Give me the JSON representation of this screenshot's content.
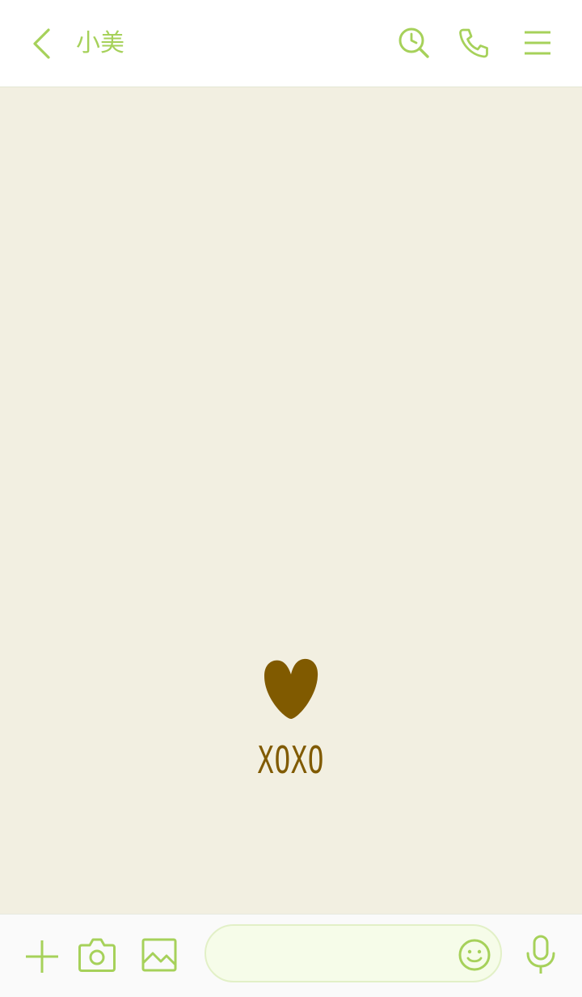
{
  "header": {
    "contact_name": "小美"
  },
  "chat": {
    "sticker_text": "XOXO"
  },
  "composer": {
    "message_value": "",
    "message_placeholder": ""
  },
  "colors": {
    "accent_green": "#a6d15a",
    "chat_background": "#f2efe1",
    "sticker_brown": "#805a00"
  },
  "icons": [
    "back-arrow-icon",
    "search-history-icon",
    "phone-icon",
    "menu-icon",
    "plus-icon",
    "camera-icon",
    "image-icon",
    "emoji-icon",
    "microphone-icon",
    "heart-icon"
  ]
}
